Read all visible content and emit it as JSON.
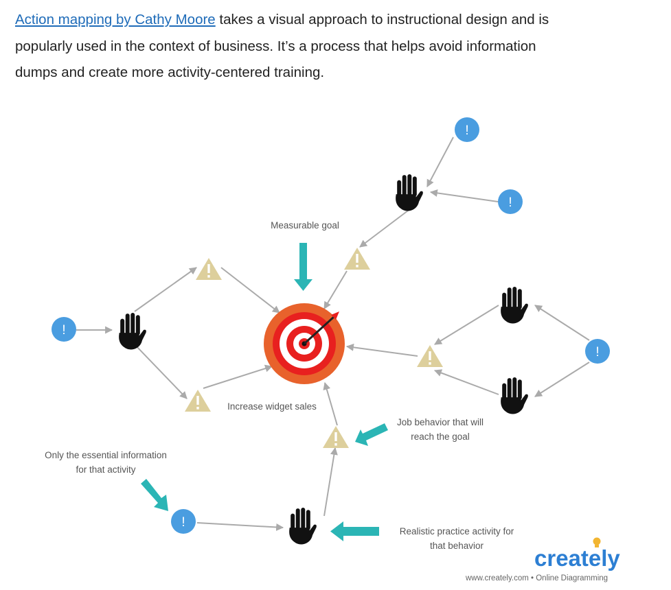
{
  "intro": {
    "link_text": "Action mapping by Cathy Moore",
    "line1_rest": " takes a visual approach to instructional design and is",
    "line2": "popularly used in the context of business. It’s a process that helps avoid information",
    "line3": "dumps and create more activity-centered training."
  },
  "diagram": {
    "labels": {
      "measurable_goal": "Measurable goal",
      "goal_text": "Increase widget sales",
      "job_behavior_1": "Job behavior that will",
      "job_behavior_2": "reach the goal",
      "essential_info_1": "Only the essential information",
      "essential_info_2": "for that activity",
      "practice_1": "Realistic practice activity for",
      "practice_2": "that behavior"
    },
    "icon_glyphs": {
      "info": "!",
      "warning": "!"
    },
    "colors": {
      "info_circle": "#4a9de0",
      "warning_triangle": "#ddcf9c",
      "warning_mark": "#ffffff",
      "teal_arrow": "#2bb5b5",
      "connector": "#aaaaaa",
      "target_outer": "#e8622c",
      "target_red": "#e8201f",
      "hand": "#111111"
    }
  },
  "brand": {
    "logo_main": "creat",
    "logo_end": "ly",
    "logo_e": "e",
    "tagline": "www.creately.com • Online Diagramming"
  }
}
